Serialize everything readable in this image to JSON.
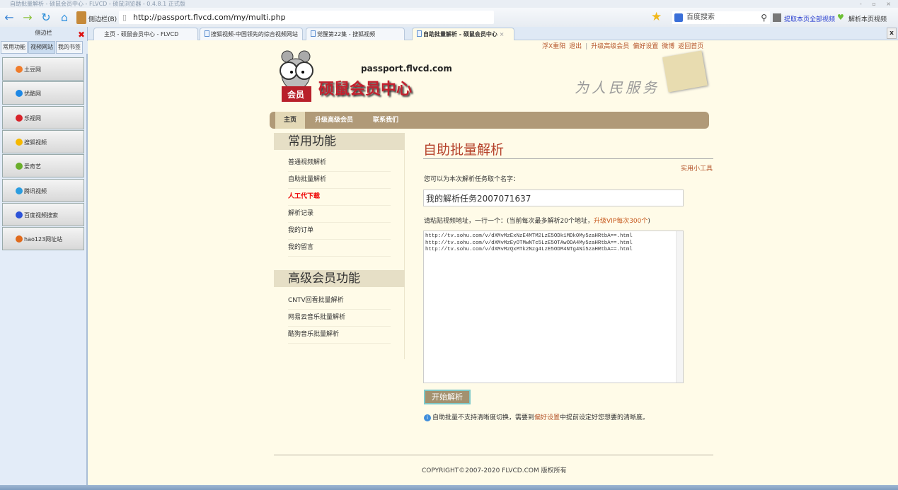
{
  "window": {
    "title": "自助批量解析 - 硕鼠会员中心 - FLVCD - 硕鼠浏览器 - 0.4.8.1 正式版",
    "controls": "- ▫ ×"
  },
  "toolbar": {
    "sidebar_label": "侧边栏(B)",
    "url": "http://passport.flvcd.com/my/multi.php",
    "search_placeholder": "百度搜索",
    "extract_all": "提取本页全部视频",
    "parse_page": "解析本页视频"
  },
  "sidebar": {
    "title": "侧边栏",
    "tabs": [
      "常用功能",
      "视频网站",
      "我的书签"
    ],
    "items": [
      {
        "label": "土豆网",
        "color": "#f07c2b"
      },
      {
        "label": "优酷网",
        "color": "#1e88e5"
      },
      {
        "label": "乐视网",
        "color": "#d8232a"
      },
      {
        "label": "搜狐视频",
        "color": "#f5b800"
      },
      {
        "label": "爱奇艺",
        "color": "#6aae2b"
      },
      {
        "label": "腾讯视频",
        "color": "#2b9de0"
      },
      {
        "label": "百度视频搜索",
        "color": "#2d53d8"
      },
      {
        "label": "hao123网址站",
        "color": "#e06a1c"
      }
    ]
  },
  "tabs": [
    {
      "label": "主页 - 硕鼠会员中心 - FLVCD"
    },
    {
      "label": "搜狐视频-中国领先的综合视频网站"
    },
    {
      "label": "觉醒第22集 - 搜狐视频"
    },
    {
      "label": "自助批量解析 - 硕鼠会员中心",
      "close": "×"
    }
  ],
  "close_all": "x",
  "header": {
    "links": [
      "浮X重阳",
      "退出",
      "|",
      "升级高级会员",
      "偏好设置",
      "微博",
      "返回首页"
    ],
    "domain": "passport.flvcd.com",
    "logo_text": "硕鼠会员中心",
    "badge": "会员",
    "slogan": "为人民服务"
  },
  "nav": [
    "主页",
    "升级高级会员",
    "联系我们"
  ],
  "left": {
    "section1": "常用功能",
    "items1": [
      "普通视频解析",
      "自助批量解析",
      "人工代下载",
      "解析记录",
      "我的订单",
      "我的留言"
    ],
    "section2": "高级会员功能",
    "items2": [
      "CNTV回看批量解析",
      "网易云音乐批量解析",
      "酷狗音乐批量解析"
    ]
  },
  "main": {
    "title": "自助批量解析",
    "tools": "实用小工具",
    "name_label": "您可以为本次解析任务取个名字：",
    "name_value": "我的解析任务2007071637",
    "urls_label": "请粘贴视频地址，一行一个：(当前每次最多解析20个地址，",
    "urls_vip": "升级VIP每次300个",
    "urls_close": ")",
    "urls": "http://tv.sohu.com/v/dXMvMzExNzE4MTM2LzE5ODk1MDk0My5zaHRtbA==.html\nhttp://tv.sohu.com/v/dXMvMzEyOTMwNTc5LzE5OTAwODA4My5zaHRtbA==.html\nhttp://tv.sohu.com/v/dXMvMzQxMTk2Nzg4LzE5ODM4NTg4Ni5zaHRtbA==.html",
    "start": "开始解析",
    "info_a": "自助批量不支持清晰度切换，需要到",
    "info_link": "偏好设置",
    "info_b": "中提前设定好您想要的清晰度。"
  },
  "footer": {
    "copyright": "COPYRIGHT©2007-2020 FLVCD.COM 版权所有"
  }
}
